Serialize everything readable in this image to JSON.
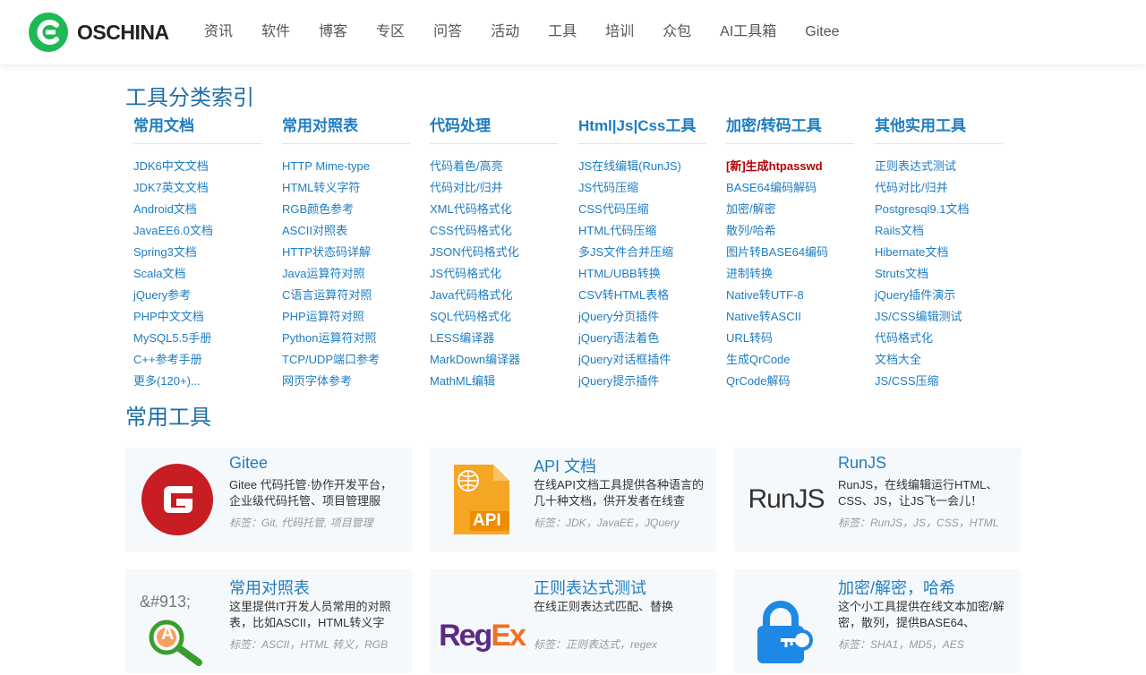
{
  "header": {
    "logo_text": "OSCHINA",
    "nav": [
      "资讯",
      "软件",
      "博客",
      "专区",
      "问答",
      "活动",
      "工具",
      "培训",
      "众包",
      "AI工具箱",
      "Gitee"
    ]
  },
  "index_title": "工具分类索引",
  "categories": [
    {
      "title": "常用文档",
      "items": [
        "JDK6中文文档",
        "JDK7英文文档",
        "Android文档",
        "JavaEE6.0文档",
        "Spring3文档",
        "Scala文档",
        "jQuery参考",
        "PHP中文文档",
        "MySQL5.5手册",
        "C++参考手册",
        "更多(120+)..."
      ]
    },
    {
      "title": "常用对照表",
      "items": [
        "HTTP Mime-type",
        "HTML转义字符",
        "RGB颜色参考",
        "ASCII对照表",
        "HTTP状态码详解",
        "Java运算符对照",
        "C语言运算符对照",
        "PHP运算符对照",
        "Python运算符对照",
        "TCP/UDP端口参考",
        "网页字体参考"
      ]
    },
    {
      "title": "代码处理",
      "items": [
        "代码着色/高亮",
        "代码对比/归并",
        "XML代码格式化",
        "CSS代码格式化",
        "JSON代码格式化",
        "JS代码格式化",
        "Java代码格式化",
        "SQL代码格式化",
        "LESS编译器",
        "MarkDown编译器",
        "MathML编辑"
      ]
    },
    {
      "title": "Html|Js|Css工具",
      "items": [
        "JS在线编辑(RunJS)",
        "JS代码压缩",
        "CSS代码压缩",
        "HTML代码压缩",
        "多JS文件合并压缩",
        "HTML/UBB转换",
        "CSV转HTML表格",
        "jQuery分页插件",
        "jQuery语法着色",
        "jQuery对话框插件",
        "jQuery提示插件"
      ]
    },
    {
      "title": "加密/转码工具",
      "items": [
        "[新]生成htpasswd",
        "BASE64编码解码",
        "加密/解密",
        "散列/哈希",
        "图片转BASE64编码",
        "进制转换",
        "Native转UTF-8",
        "Native转ASCII",
        "URL转码",
        "生成QrCode",
        "QrCode解码"
      ]
    },
    {
      "title": "其他实用工具",
      "items": [
        "正则表达式测试",
        "代码对比/归并",
        "Postgresql9.1文档",
        "Rails文档",
        "Hibernate文档",
        "Struts文档",
        "jQuery插件演示",
        "JS/CSS编辑测试",
        "代码格式化",
        "文档大全",
        "JS/CSS压缩"
      ]
    }
  ],
  "tools_title": "常用工具",
  "cards": [
    {
      "title": "Gitee",
      "desc": "Gitee 代码托管·协作开发平台，企业级代码托管、项目管理服",
      "tags": "标签：Git, 代码托管, 项目管理",
      "icon": "gitee-logo-icon"
    },
    {
      "title": "API 文档",
      "desc": "在线API文档工具提供各种语言的几十种文档，供开发者在线查",
      "tags": "标签：JDK，JavaEE，JQuery",
      "icon": "api-doc-icon",
      "icon_text": "API"
    },
    {
      "title": "RunJS",
      "desc": "RunJS，在线编辑运行HTML、CSS、JS，让JS飞一会儿！",
      "tags": "标签：RunJS，JS，CSS，HTML",
      "icon": "runjs-logo-icon",
      "icon_text": "RunJS"
    },
    {
      "title": "常用对照表",
      "desc": "这里提供IT开发人员常用的对照表，比如ASCII，HTML转义字",
      "tags": "标签：ASCII，HTML 转义，RGB",
      "icon": "magnifier-icon",
      "icon_text": "&#913;",
      "icon_letter": "A"
    },
    {
      "title": "正则表达式测试",
      "desc": "在线正则表达式匹配、替换",
      "tags": "标签：正则表达式，regex",
      "icon": "regex-logo-icon",
      "icon_text_1": "Reg",
      "icon_text_2": "Ex"
    },
    {
      "title": "加密/解密，哈希",
      "desc": "这个小工具提供在线文本加密/解密，散列，提供BASE64、",
      "tags": "标签：SHA1，MD5，AES",
      "icon": "lock-key-icon"
    }
  ],
  "colors": {
    "link": "#1e7dc2",
    "title": "#1e6fa8",
    "logo_green": "#1db954",
    "highlight": "#b40000"
  }
}
